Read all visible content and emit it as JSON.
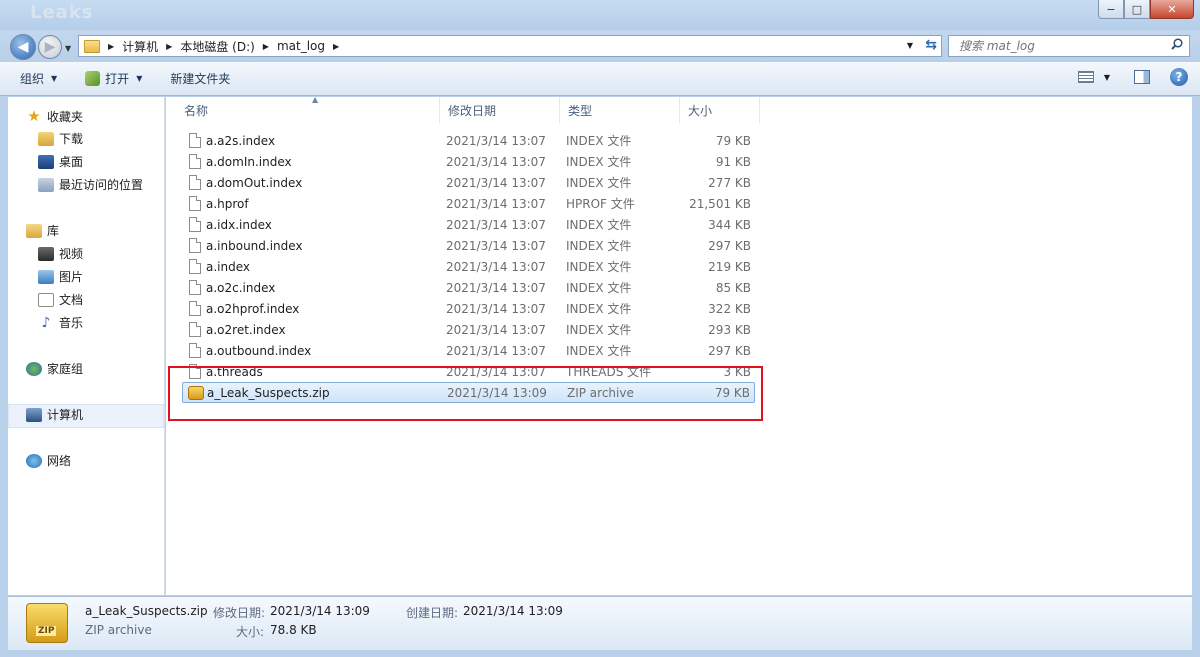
{
  "window": {
    "title": "Leaks",
    "min": "−",
    "max": "□",
    "close": "✕"
  },
  "address": {
    "crumbs": [
      "计算机",
      "本地磁盘 (D:)",
      "mat_log"
    ],
    "search_placeholder": "搜索 mat_log"
  },
  "toolbar": {
    "organize": "组织",
    "open": "打开",
    "new_folder": "新建文件夹"
  },
  "nav": {
    "favorites": "收藏夹",
    "downloads": "下载",
    "desktop": "桌面",
    "recent": "最近访问的位置",
    "libraries": "库",
    "videos": "视频",
    "pictures": "图片",
    "documents": "文档",
    "music": "音乐",
    "homegroup": "家庭组",
    "computer": "计算机",
    "network": "网络"
  },
  "columns": {
    "name": "名称",
    "date": "修改日期",
    "type": "类型",
    "size": "大小"
  },
  "files": [
    {
      "name": "a.a2s.index",
      "date": "2021/3/14 13:07",
      "type": "INDEX 文件",
      "size": "79 KB"
    },
    {
      "name": "a.domIn.index",
      "date": "2021/3/14 13:07",
      "type": "INDEX 文件",
      "size": "91 KB"
    },
    {
      "name": "a.domOut.index",
      "date": "2021/3/14 13:07",
      "type": "INDEX 文件",
      "size": "277 KB"
    },
    {
      "name": "a.hprof",
      "date": "2021/3/14 13:07",
      "type": "HPROF 文件",
      "size": "21,501 KB"
    },
    {
      "name": "a.idx.index",
      "date": "2021/3/14 13:07",
      "type": "INDEX 文件",
      "size": "344 KB"
    },
    {
      "name": "a.inbound.index",
      "date": "2021/3/14 13:07",
      "type": "INDEX 文件",
      "size": "297 KB"
    },
    {
      "name": "a.index",
      "date": "2021/3/14 13:07",
      "type": "INDEX 文件",
      "size": "219 KB"
    },
    {
      "name": "a.o2c.index",
      "date": "2021/3/14 13:07",
      "type": "INDEX 文件",
      "size": "85 KB"
    },
    {
      "name": "a.o2hprof.index",
      "date": "2021/3/14 13:07",
      "type": "INDEX 文件",
      "size": "322 KB"
    },
    {
      "name": "a.o2ret.index",
      "date": "2021/3/14 13:07",
      "type": "INDEX 文件",
      "size": "293 KB"
    },
    {
      "name": "a.outbound.index",
      "date": "2021/3/14 13:07",
      "type": "INDEX 文件",
      "size": "297 KB"
    },
    {
      "name": "a.threads",
      "date": "2021/3/14 13:07",
      "type": "THREADS 文件",
      "size": "3 KB"
    },
    {
      "name": "a_Leak_Suspects.zip",
      "date": "2021/3/14 13:09",
      "type": "ZIP archive",
      "size": "79 KB"
    }
  ],
  "details": {
    "name": "a_Leak_Suspects.zip",
    "type": "ZIP archive",
    "icon_label": "ZIP",
    "modified_label": "修改日期:",
    "modified_value": "2021/3/14 13:09",
    "created_label": "创建日期:",
    "created_value": "2021/3/14 13:09",
    "size_label": "大小:",
    "size_value": "78.8 KB"
  }
}
